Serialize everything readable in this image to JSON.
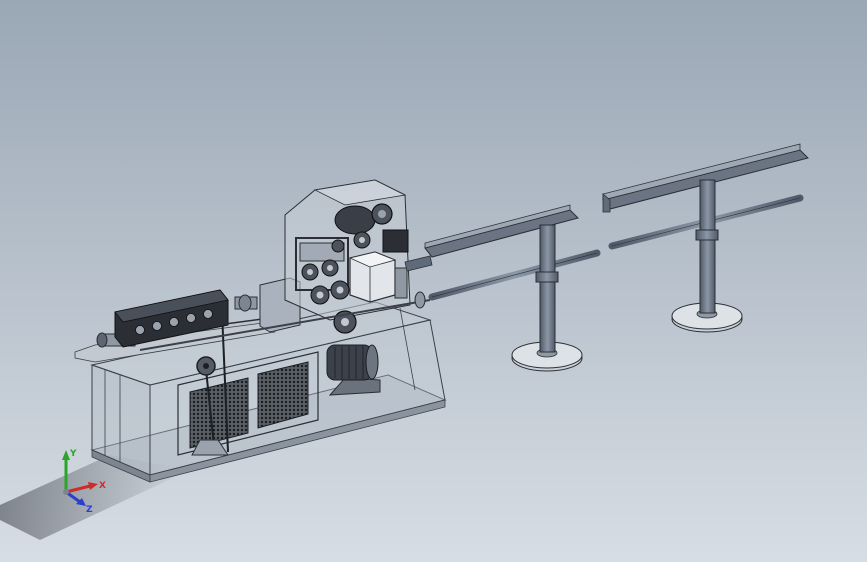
{
  "viewport": {
    "background_top": "#9aa7b5",
    "background_bottom": "#d7dde4"
  },
  "triad": {
    "x_label": "X",
    "y_label": "Y",
    "z_label": "Z",
    "x_color": "#d12a2a",
    "y_color": "#2aa52a",
    "z_color": "#2a3fd1"
  },
  "model": {
    "frame_color": "#8e98a3",
    "metal_color": "#5f6a7a",
    "dark_color": "#2a2d33",
    "mesh_color": "#1c1f24"
  }
}
